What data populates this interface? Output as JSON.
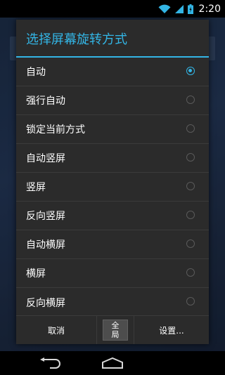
{
  "status_bar": {
    "time": "2:20",
    "icons": [
      "wifi-icon",
      "signal-icon",
      "battery-icon"
    ]
  },
  "dialog": {
    "title": "选择屏幕旋转方式",
    "options": [
      {
        "label": "自动",
        "selected": true
      },
      {
        "label": "强行自动",
        "selected": false
      },
      {
        "label": "锁定当前方式",
        "selected": false
      },
      {
        "label": "自动竖屏",
        "selected": false
      },
      {
        "label": "竖屏",
        "selected": false
      },
      {
        "label": "反向竖屏",
        "selected": false
      },
      {
        "label": "自动横屏",
        "selected": false
      },
      {
        "label": "横屏",
        "selected": false
      },
      {
        "label": "反向横屏",
        "selected": false
      }
    ],
    "buttons": {
      "cancel": "取消",
      "global_line1": "全",
      "global_line2": "局",
      "settings": "设置..."
    }
  },
  "nav_bar": {
    "icons": [
      "back-icon",
      "home-icon"
    ]
  },
  "colors": {
    "accent": "#33b5e5",
    "dialog_bg": "#2b2b2b"
  }
}
